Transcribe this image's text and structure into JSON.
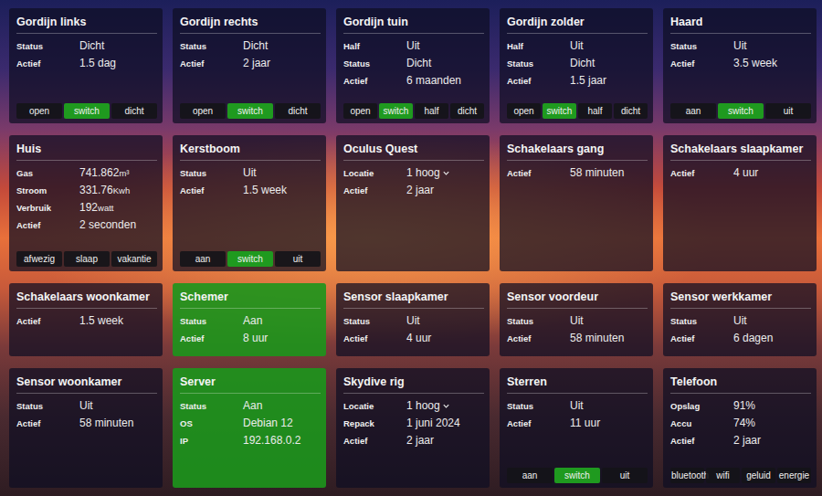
{
  "dashboard": {
    "cards": [
      {
        "title": "Gordijn links",
        "on": false,
        "rows": [
          {
            "label": "Status",
            "value": "Dicht"
          },
          {
            "label": "Actief",
            "value": "1.5 dag"
          }
        ],
        "buttons": [
          {
            "label": "open",
            "selected": false
          },
          {
            "label": "switch",
            "selected": true
          },
          {
            "label": "dicht",
            "selected": false
          }
        ]
      },
      {
        "title": "Gordijn rechts",
        "on": false,
        "rows": [
          {
            "label": "Status",
            "value": "Dicht"
          },
          {
            "label": "Actief",
            "value": "2 jaar"
          }
        ],
        "buttons": [
          {
            "label": "open",
            "selected": false
          },
          {
            "label": "switch",
            "selected": true
          },
          {
            "label": "dicht",
            "selected": false
          }
        ]
      },
      {
        "title": "Gordijn tuin",
        "on": false,
        "rows": [
          {
            "label": "Half",
            "value": "Uit"
          },
          {
            "label": "Status",
            "value": "Dicht"
          },
          {
            "label": "Actief",
            "value": "6 maanden"
          }
        ],
        "buttons": [
          {
            "label": "open",
            "selected": false
          },
          {
            "label": "switch",
            "selected": true
          },
          {
            "label": "half",
            "selected": false
          },
          {
            "label": "dicht",
            "selected": false
          }
        ]
      },
      {
        "title": "Gordijn zolder",
        "on": false,
        "rows": [
          {
            "label": "Half",
            "value": "Uit"
          },
          {
            "label": "Status",
            "value": "Dicht"
          },
          {
            "label": "Actief",
            "value": "1.5 jaar"
          }
        ],
        "buttons": [
          {
            "label": "open",
            "selected": false
          },
          {
            "label": "switch",
            "selected": true
          },
          {
            "label": "half",
            "selected": false
          },
          {
            "label": "dicht",
            "selected": false
          }
        ]
      },
      {
        "title": "Haard",
        "on": false,
        "rows": [
          {
            "label": "Status",
            "value": "Uit"
          },
          {
            "label": "Actief",
            "value": "3.5 week"
          }
        ],
        "buttons": [
          {
            "label": "aan",
            "selected": false
          },
          {
            "label": "switch",
            "selected": true
          },
          {
            "label": "uit",
            "selected": false
          }
        ]
      },
      {
        "title": "Huis",
        "on": false,
        "rows": [
          {
            "label": "Gas",
            "value": "741.862",
            "unit": "m³"
          },
          {
            "label": "Stroom",
            "value": "331.76",
            "unit": "Kwh"
          },
          {
            "label": "Verbruik",
            "value": "192",
            "unit": "watt"
          },
          {
            "label": "Actief",
            "value": "2 seconden"
          }
        ],
        "buttons": [
          {
            "label": "afwezig",
            "selected": false
          },
          {
            "label": "slaap",
            "selected": false
          },
          {
            "label": "vakantie",
            "selected": false
          }
        ]
      },
      {
        "title": "Kerstboom",
        "on": false,
        "rows": [
          {
            "label": "Status",
            "value": "Uit"
          },
          {
            "label": "Actief",
            "value": "1.5 week"
          }
        ],
        "buttons": [
          {
            "label": "aan",
            "selected": false
          },
          {
            "label": "switch",
            "selected": true
          },
          {
            "label": "uit",
            "selected": false
          }
        ]
      },
      {
        "title": "Oculus Quest",
        "on": false,
        "rows": [
          {
            "label": "Locatie",
            "value": "1 hoog",
            "dropdown": true
          },
          {
            "label": "Actief",
            "value": "2 jaar"
          }
        ],
        "buttons": []
      },
      {
        "title": "Schakelaars gang",
        "on": false,
        "rows": [
          {
            "label": "Actief",
            "value": "58 minuten"
          }
        ],
        "buttons": []
      },
      {
        "title": "Schakelaars slaapkamer",
        "on": false,
        "rows": [
          {
            "label": "Actief",
            "value": "4 uur"
          }
        ],
        "buttons": []
      },
      {
        "title": "Schakelaars woonkamer",
        "on": false,
        "rows": [
          {
            "label": "Actief",
            "value": "1.5 week"
          }
        ],
        "buttons": []
      },
      {
        "title": "Schemer",
        "on": true,
        "rows": [
          {
            "label": "Status",
            "value": "Aan"
          },
          {
            "label": "Actief",
            "value": "8 uur"
          }
        ],
        "buttons": []
      },
      {
        "title": "Sensor slaapkamer",
        "on": false,
        "rows": [
          {
            "label": "Status",
            "value": "Uit"
          },
          {
            "label": "Actief",
            "value": "4 uur"
          }
        ],
        "buttons": []
      },
      {
        "title": "Sensor voordeur",
        "on": false,
        "rows": [
          {
            "label": "Status",
            "value": "Uit"
          },
          {
            "label": "Actief",
            "value": "58 minuten"
          }
        ],
        "buttons": []
      },
      {
        "title": "Sensor werkkamer",
        "on": false,
        "rows": [
          {
            "label": "Status",
            "value": "Uit"
          },
          {
            "label": "Actief",
            "value": "6 dagen"
          }
        ],
        "buttons": []
      },
      {
        "title": "Sensor woonkamer",
        "on": false,
        "rows": [
          {
            "label": "Status",
            "value": "Uit"
          },
          {
            "label": "Actief",
            "value": "58 minuten"
          }
        ],
        "buttons": []
      },
      {
        "title": "Server",
        "on": true,
        "rows": [
          {
            "label": "Status",
            "value": "Aan"
          },
          {
            "label": "OS",
            "value": "Debian 12"
          },
          {
            "label": "IP",
            "value": "192.168.0.2"
          }
        ],
        "buttons": []
      },
      {
        "title": "Skydive rig",
        "on": false,
        "rows": [
          {
            "label": "Locatie",
            "value": "1 hoog",
            "dropdown": true
          },
          {
            "label": "Repack",
            "value": "1 juni 2024"
          },
          {
            "label": "Actief",
            "value": "2 jaar"
          }
        ],
        "buttons": []
      },
      {
        "title": "Sterren",
        "on": false,
        "rows": [
          {
            "label": "Status",
            "value": "Uit"
          },
          {
            "label": "Actief",
            "value": "11 uur"
          }
        ],
        "buttons": [
          {
            "label": "aan",
            "selected": false
          },
          {
            "label": "switch",
            "selected": true
          },
          {
            "label": "uit",
            "selected": false
          }
        ]
      },
      {
        "title": "Telefoon",
        "on": false,
        "rows": [
          {
            "label": "Opslag",
            "value": "91%"
          },
          {
            "label": "Accu",
            "value": "74%"
          },
          {
            "label": "Actief",
            "value": "2 jaar"
          }
        ],
        "buttons": [
          {
            "label": "bluetooth",
            "selected": false
          },
          {
            "label": "wifi",
            "selected": false
          },
          {
            "label": "geluid",
            "selected": false
          },
          {
            "label": "energie",
            "selected": false
          }
        ]
      }
    ]
  }
}
